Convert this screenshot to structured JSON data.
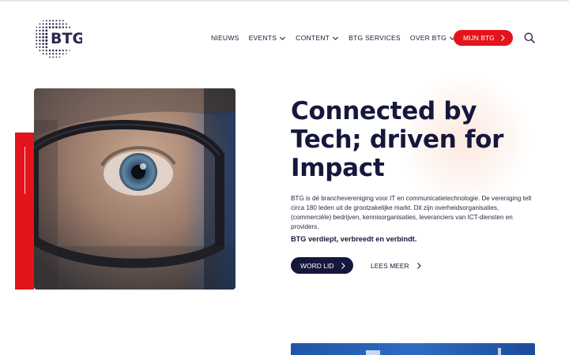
{
  "header": {
    "logo_text": "BTG",
    "nav": [
      {
        "label": "NIEUWS",
        "dropdown": false
      },
      {
        "label": "EVENTS",
        "dropdown": true
      },
      {
        "label": "CONTENT",
        "dropdown": true
      },
      {
        "label": "BTG SERVICES",
        "dropdown": false
      },
      {
        "label": "OVER BTG",
        "dropdown": true
      }
    ],
    "cta_label": "MIJN BTG",
    "search_icon": "search-icon"
  },
  "hero": {
    "title": "Connected by Tech; driven for Impact",
    "description": "BTG is dé branchevereniging voor IT en communicatietechnologie. De vereniging telt circa 180 leden uit de grootzakelijke markt. Dit zijn overheidsorganisaties, (commerciële) bedrijven, kennisorganisaties, leveranciers van ICT-diensten en providers.",
    "tagline": "BTG verdiept, verbreedt en verbindt.",
    "primary_button": "WORD LID",
    "secondary_button": "LEES MEER",
    "image_icon": "glasses-closeup-photo"
  },
  "colors": {
    "brand_red": "#e3141b",
    "navy": "#16173d",
    "glow": "#fde5d9"
  }
}
